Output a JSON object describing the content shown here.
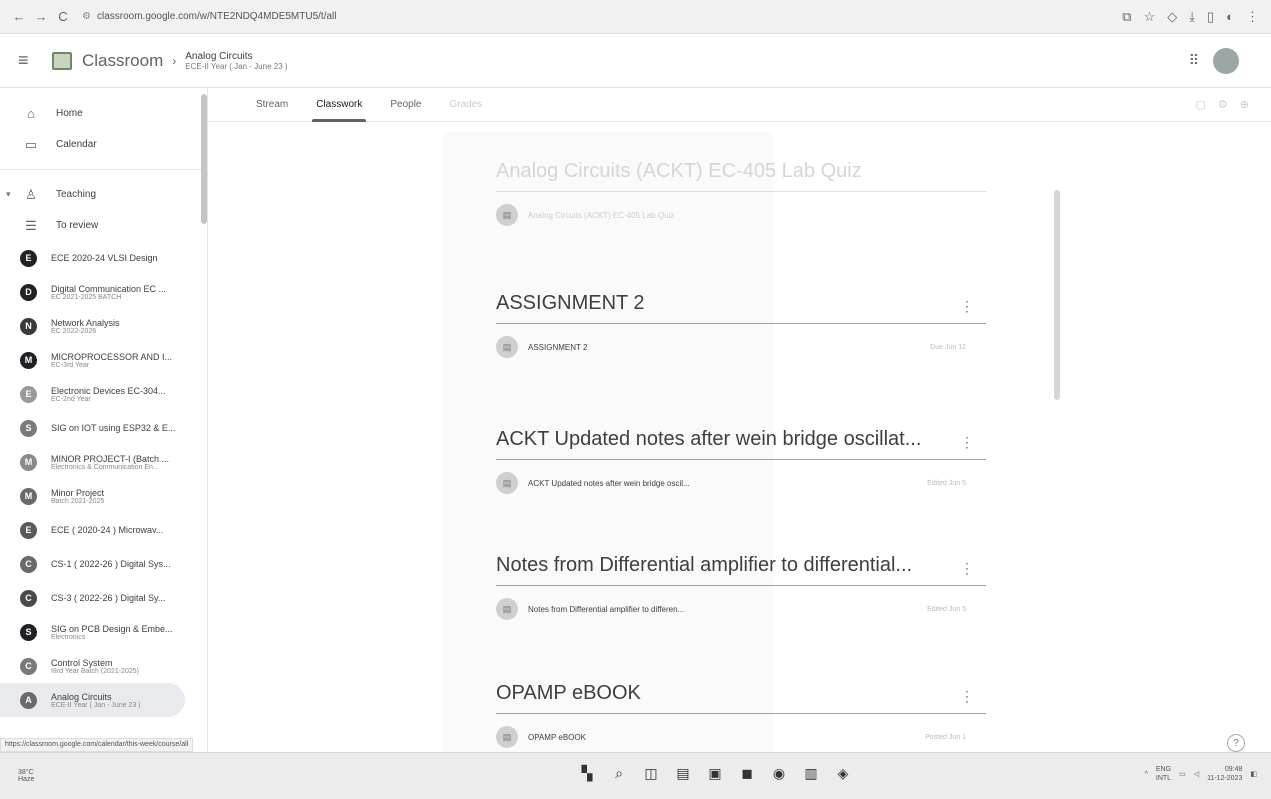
{
  "browser": {
    "url": "classroom.google.com/w/NTE2NDQ4MDE5MTU5/t/all",
    "back": "←",
    "forward": "→",
    "reload": "C"
  },
  "header": {
    "app_title": "Classroom",
    "course_name": "Analog Circuits",
    "course_sub": "ECE-II Year ( Jan - June 23 )"
  },
  "sidebar": {
    "items": [
      {
        "label": "Home",
        "icon": "home-icon",
        "glyph": "⌂"
      },
      {
        "label": "Calendar",
        "icon": "calendar-icon",
        "glyph": "▭"
      }
    ],
    "teaching": {
      "label": "Teaching",
      "icon": "people-icon",
      "glyph": "👥"
    },
    "review": {
      "label": "To review",
      "icon": "review-icon",
      "glyph": "☰"
    },
    "courses": [
      {
        "letter": "E",
        "title": "ECE 2020-24 VLSI Design",
        "sub": "",
        "color": "#202124"
      },
      {
        "letter": "D",
        "title": "Digital Communication EC ...",
        "sub": "EC 2021-2025 BATCH",
        "color": "#202124"
      },
      {
        "letter": "N",
        "title": "Network Analysis",
        "sub": "EC 2022-2026",
        "color": "#3a3a3a"
      },
      {
        "letter": "M",
        "title": "MICROPROCESSOR AND I...",
        "sub": "EC-3rd Year",
        "color": "#202124"
      },
      {
        "letter": "E",
        "title": "Electronic Devices EC-304...",
        "sub": "EC-2nd Year",
        "color": "#9a9a9a"
      },
      {
        "letter": "S",
        "title": "SIG on IOT using ESP32 & E...",
        "sub": "",
        "color": "#7a7a7a"
      },
      {
        "letter": "M",
        "title": "MINOR PROJECT-I (Batch ...",
        "sub": "Electronics & Communication En...",
        "color": "#8a8a8a"
      },
      {
        "letter": "M",
        "title": "Minor Project",
        "sub": "Batch 2021-2025",
        "color": "#6a6a6a"
      },
      {
        "letter": "E",
        "title": "ECE ( 2020-24 ) Microwav...",
        "sub": "",
        "color": "#5a5a5a"
      },
      {
        "letter": "C",
        "title": "CS-1 ( 2022-26 ) Digital Sys...",
        "sub": "",
        "color": "#6a6a6a"
      },
      {
        "letter": "C",
        "title": "CS-3 ( 2022-26 ) Digital Sy...",
        "sub": "",
        "color": "#4a4a4a"
      },
      {
        "letter": "S",
        "title": "SIG on PCB Design & Embe...",
        "sub": "Electronics",
        "color": "#202124"
      },
      {
        "letter": "C",
        "title": "Control System",
        "sub": "IIIrd Year Batch (2021-2025)",
        "color": "#7a7a7a"
      },
      {
        "letter": "A",
        "title": "Analog Circuits",
        "sub": "ECE-II Year ( Jan - June 23 )",
        "color": "#6a6a6a"
      }
    ]
  },
  "tabs": [
    "Stream",
    "Classwork",
    "People",
    "Grades"
  ],
  "topics": [
    {
      "title": "Analog Circuits (ACKT) EC-405 Lab Quiz",
      "material": "Analog Circuits (ACKT) EC-405 Lab Quiz",
      "date": "",
      "ghost": true
    },
    {
      "title": "ASSIGNMENT 2",
      "material": "ASSIGNMENT 2",
      "date": "Due Jun 12",
      "ghost": false
    },
    {
      "title": "ACKT Updated notes after wein bridge oscillat...",
      "material": "ACKT Updated notes after wein bridge oscil...",
      "date": "Edited Jun 5",
      "ghost": false
    },
    {
      "title": "Notes from Differential amplifier to differential...",
      "material": "Notes from Differential amplifier to differen...",
      "date": "Edited Jun 5",
      "ghost": false
    },
    {
      "title": "OPAMP eBOOK",
      "material": "OPAMP eBOOK",
      "date": "Posted Jun 1",
      "ghost": false
    }
  ],
  "status_url": "https://classroom.google.com/calendar/this-week/course/all",
  "taskbar": {
    "weather_temp": "38°C",
    "weather_desc": "Haze",
    "lang_top": "ENG",
    "lang_bottom": "INTL",
    "time": "09:48",
    "date": "11-12-2023"
  }
}
